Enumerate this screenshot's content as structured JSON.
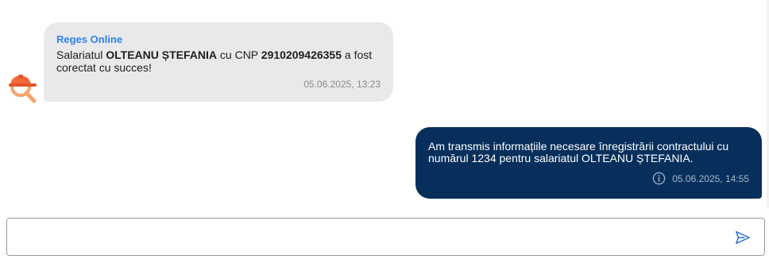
{
  "incoming": {
    "sender": "Reges Online",
    "text_1": "Salariatul ",
    "name": "OLTEANU  ȘTEFANIA",
    "text_2": " cu CNP ",
    "cnp": "2910209426355",
    "text_3": " a fost corectat cu succes!",
    "timestamp": "05.06.2025, 13:23"
  },
  "outgoing": {
    "text": "Am transmis informațiile necesare înregistrării contractului cu numărul 1234 pentru salariatul OLTEANU  ȘTEFANIA.",
    "timestamp": "05.06.2025, 14:55"
  },
  "composer": {
    "value": "",
    "placeholder": ""
  },
  "colors": {
    "sender": "#2f80ed",
    "incoming_bg": "#e9e9ec",
    "outgoing_bg": "#062f5c",
    "avatar_accent": "#f26b3a",
    "send_icon": "#2f6fd6"
  },
  "icons": {
    "avatar": "bot-avatar-icon",
    "info": "info-icon",
    "send": "send-icon"
  }
}
